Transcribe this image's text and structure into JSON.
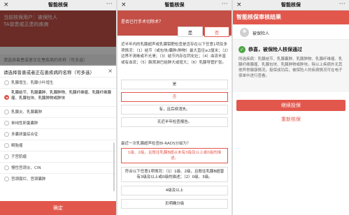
{
  "wechat": {
    "title": "智能核保",
    "close_glyph": "×",
    "more_glyph": "···"
  },
  "panel1": {
    "banner_line1": "当前核保用户：被保险人",
    "banner_line2": "TA曾患或正患的疾病",
    "prompt_text": "请选择曾患或者正在患疾病的名称（可多选）",
    "sheet_title": "请选择曾患或者正在患疾病的名称（可多选）",
    "sheet_close": "×",
    "options": [
      {
        "label": "乳腺增生、乳腺小叶增生",
        "selected": false
      },
      {
        "label": "乳腺结节、乳腺囊肿、乳腺肿物、乳腺纤维瘤、乳腺纤维腺瘤、乳腺包块、乳腺肿物或肿块",
        "selected": true
      },
      {
        "label": "乳腺炎、乳腺囊肿",
        "selected": false
      },
      {
        "label": "单纯性卵巢囊肿",
        "selected": false
      },
      {
        "label": "多囊卵巢综合征",
        "selected": false
      },
      {
        "label": "畸胎瘤",
        "selected": false
      },
      {
        "label": "子宫肌瘤",
        "selected": false
      },
      {
        "label": "慢性宫颈炎、CIN",
        "selected": false
      },
      {
        "label": "宫颈糜烂、宫颈囊肿",
        "selected": false
      }
    ],
    "confirm_label": "确定"
  },
  "panel2": {
    "q1": "是否已行手术切除术？",
    "yes_label": "是",
    "no_label": "否",
    "q2": "近半年内的乳腺超声或乳腺钼靶检查是否存在以下任意1项及多项情况：（1）结节（或包块/囊肿/肿物）最大直径≥2厘米；（2）边界不清晰或不光滑；（3）结节内存在钙化灶；（4）血流丰富或有血流；（5）腋窝淋巴结肿大或增大；（6）乳腺导管扩张。",
    "q2_answers": [
      {
        "label": "是",
        "selected": false
      },
      {
        "label": "否",
        "selected": true
      },
      {
        "label": "有，且后续消失。",
        "selected": false
      },
      {
        "label": "无近半年检查报告。",
        "selected": false
      }
    ],
    "q3": "最近一次乳腺超声检查BI-RADS分级为？",
    "q3_answers": [
      {
        "label": "1级、2级，且既往乳腺B超从未有3级及以上或0级的描述。",
        "selected": true
      },
      {
        "label": "符合以下任意1项情况：（1）1级、2级，且既往乳腺B超曾有3级及以上或0级的描述；（2）0级、3级。",
        "selected": false
      },
      {
        "label": "4级及以上",
        "selected": false
      },
      {
        "label": "无明确分级",
        "selected": false
      }
    ]
  },
  "panel3": {
    "header": "智能核保审核结果",
    "user": "被保险人",
    "pass_text": "恭喜，被保险人核保通过",
    "detail": "所选疾病：乳腺结节、乳腺囊肿、乳腺肿物、乳腺纤维瘤、乳腺纤维腺瘤、乳腺包块、乳腺肿物或肿块。除以上疾病外无其他异常健康情况。投保成功后，被保险人的疾病情况可在电子保单中进行查看。",
    "check_glyph": "✓",
    "continue_label": "继续投保",
    "rerun_label": "重新核保"
  }
}
